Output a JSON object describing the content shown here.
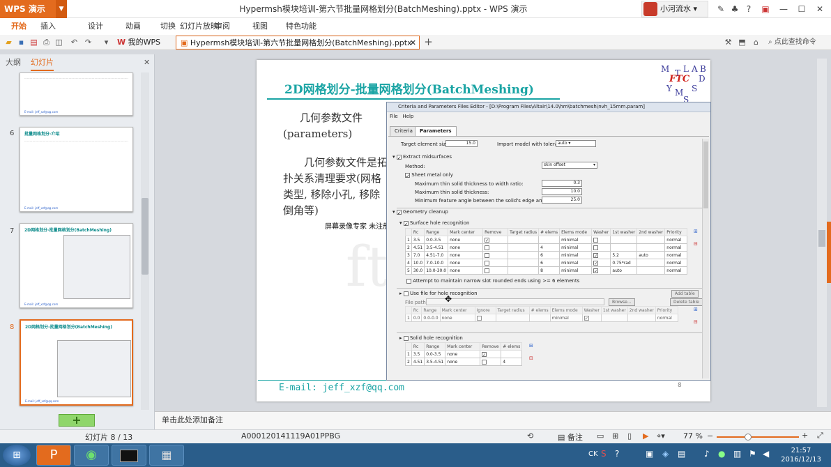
{
  "app": {
    "name": "WPS 演示",
    "window_title": "Hypermsh模块培训-第六节批量网格划分(BatchMeshing).pptx - WPS 演示",
    "user": "小河流水"
  },
  "menu": [
    "开始",
    "插入",
    "设计",
    "动画",
    "切换",
    "幻灯片放映",
    "审阅",
    "视图",
    "特色功能"
  ],
  "toolbar": {
    "tab_mywps": "我的WPS",
    "tab_doc": "Hypermsh模块培训-第六节批量网格划分(BatchMeshing).pptx",
    "search": "点此查找命令"
  },
  "panel": {
    "tabs": [
      "大纲",
      "幻灯片"
    ],
    "thumbs": [
      {
        "num": "",
        "title": "",
        "footer": "E-mail: jeff_xzf@qq.com"
      },
      {
        "num": "6",
        "title": "批量网格划分-介绍",
        "footer": "E-mail: jeff_xzf@qq.com"
      },
      {
        "num": "7",
        "title": "2D网格划分-批量网格划分(BatchMeshing)",
        "footer": "E-mail: jeff_xzf@qq.com"
      },
      {
        "num": "8",
        "title": "2D网格划分-批量网格划分(BatchMeshing)",
        "footer": "E-mail: jeff_xzf@qq.com"
      }
    ]
  },
  "slide": {
    "title": "2D网格划分-批量网格划分(BatchMeshing)",
    "subtitle": "几何参数文件(parameters)",
    "body": "几何参数文件是拓扑关系清理要求(网格类型, 移除小孔, 移除倒角等)",
    "watermark": "屏幕录像专家 未注册",
    "email": "E-mail: jeff_xzf@qq.com",
    "page": "8",
    "logo_letters": [
      "M",
      "T",
      "L",
      "A",
      "B",
      "D",
      "S",
      "Y",
      "M",
      "S"
    ],
    "logo_center": "FTC"
  },
  "dialog": {
    "title": "Criteria and Parameters Files Editor - [D:\\Program Files\\Altair\\14.0\\hm\\batchmesh\\nvh_15mm.param]",
    "menu": [
      "File",
      "Help"
    ],
    "tabs": [
      "Criteria",
      "Parameters"
    ],
    "target_label": "Target element size:",
    "target_value": "15.0",
    "import_label": "Import model with tolerance:",
    "import_value": "auto",
    "extract": "Extract midsurfaces",
    "method_label": "Method:",
    "method_value": "skin offset",
    "sheet": "Sheet metal only",
    "ratio_label": "Maximum thin solid thickness to width ratio:",
    "ratio_value": "0.3",
    "thick_label": "Maximum thin solid thickness:",
    "thick_value": "10.0",
    "angle_label": "Minimum feature angle between the solid's edge and its faces:",
    "angle_value": "25.0",
    "geom": "Geometry cleanup",
    "surf": "Surface hole recognition",
    "headers": [
      "Rc",
      "Range",
      "Mark center",
      "Remove",
      "Target radius",
      "# elems",
      "Elems mode",
      "Washer",
      "1st washer",
      "2nd washer",
      "Priority"
    ],
    "rows": [
      [
        "1",
        "3.5",
        "0.0-3.5",
        "none",
        "",
        "",
        "minimal",
        "",
        "",
        "",
        "normal"
      ],
      [
        "2",
        "4.51",
        "3.5-4.51",
        "none",
        "",
        "4",
        "minimal",
        "",
        "",
        "",
        "normal"
      ],
      [
        "3",
        "7.0",
        "4.51-7.0",
        "none",
        "",
        "6",
        "minimal",
        "",
        "5.2",
        "auto",
        "normal"
      ],
      [
        "4",
        "10.0",
        "7.0-10.0",
        "none",
        "",
        "6",
        "minimal",
        "",
        "0.75*rad",
        "",
        "normal"
      ],
      [
        "5",
        "30.0",
        "10.0-30.0",
        "none",
        "",
        "8",
        "minimal",
        "",
        "auto",
        "",
        "normal"
      ]
    ],
    "attempt": "Attempt to maintain narrow slot rounded ends using >= 6 elements",
    "usefile": "Use file for hole recognition",
    "filepath": "File path:",
    "browse": "Browse...",
    "addtable": "Add table",
    "deltable": "Delete table",
    "headers2": [
      "Rc",
      "Range",
      "Mark center",
      "Ignore",
      "Target radius",
      "# elems",
      "Elems mode",
      "Washer",
      "1st washer",
      "2nd washer",
      "Priority"
    ],
    "row2": [
      "1",
      "0.0",
      "0.0-0.0",
      "none",
      "",
      "",
      "minimal",
      "",
      "",
      "",
      "normal"
    ],
    "solid": "Solid hole recognition",
    "headers3": [
      "Rc",
      "Range",
      "Mark center",
      "Remove",
      "# elems"
    ],
    "rows3": [
      [
        "1",
        "3.5",
        "0.0-3.5",
        "none",
        ""
      ],
      [
        "2",
        "4.51",
        "3.5-4.51",
        "none",
        "4"
      ]
    ]
  },
  "notes": "单击此处添加备注",
  "status": {
    "slide": "幻灯片 8 / 13",
    "code": "A000120141119A01PPBG",
    "notes_btn": "备注",
    "zoom": "77 %"
  },
  "taskbar": {
    "time": "21:57",
    "date": "2016/12/13",
    "ime": "CK"
  }
}
